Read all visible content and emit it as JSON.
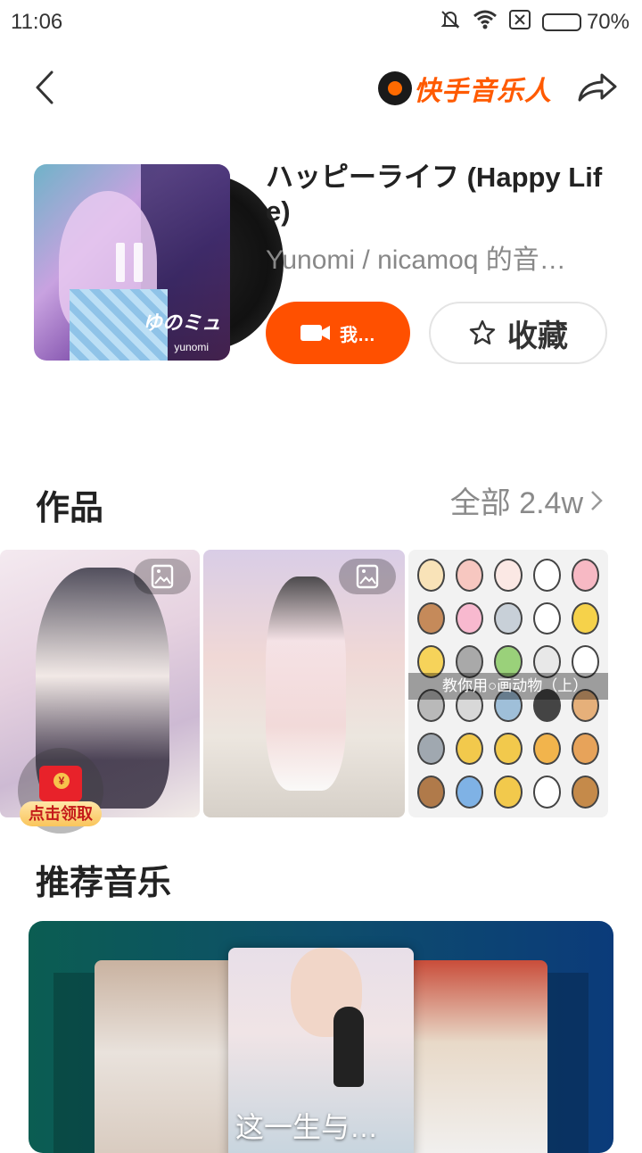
{
  "status_bar": {
    "time": "11:06",
    "battery": "70%",
    "battery_level": 0.7
  },
  "nav": {
    "logo_text": "快手音乐人"
  },
  "song": {
    "title": "ハッピーライフ (Happy Life)",
    "artist": "Yunomi / nicamoq 的音…",
    "cover_logo": "ゆのミュ",
    "cover_sub": "yunomi",
    "shoot_button": "我…",
    "favorite_button": "收藏"
  },
  "works": {
    "title": "作品",
    "all_label": "全部 2.4w",
    "items": [
      {
        "caption": ""
      },
      {
        "caption": ""
      },
      {
        "caption": "教你用○画动物（上）"
      }
    ],
    "redpack_label": "点击领取"
  },
  "recommend": {
    "title": "推荐音乐",
    "caption": "这一生与…"
  },
  "colors": {
    "accent": "#ff5000",
    "logo": "#ff5a00"
  }
}
